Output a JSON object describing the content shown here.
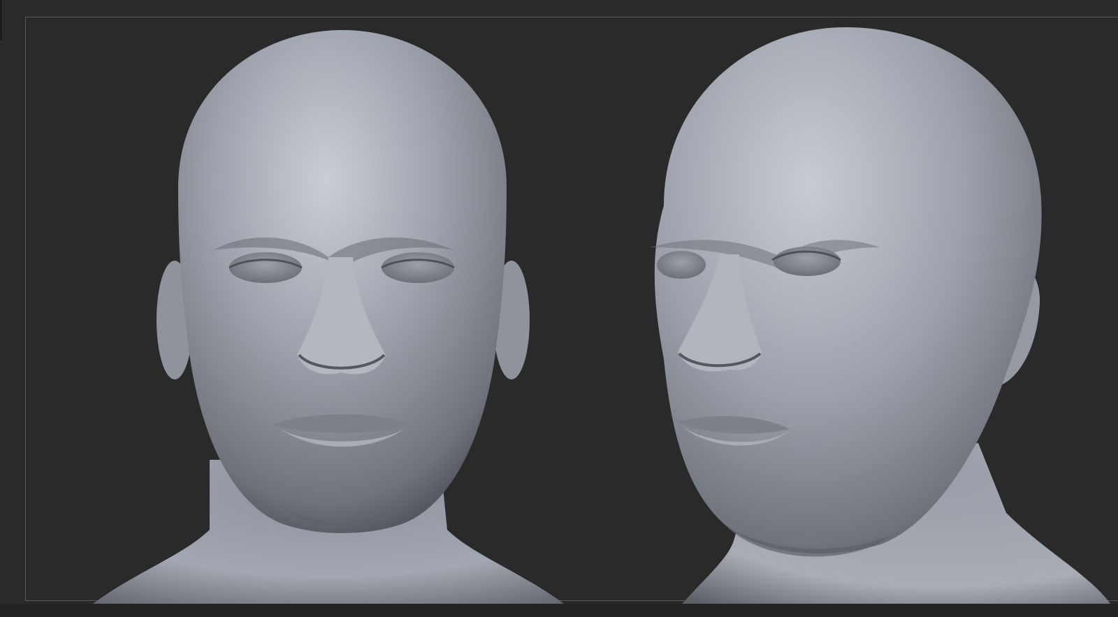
{
  "viewport": {
    "background": "#2a2a2a",
    "frame_color": "#5a5a5a"
  },
  "sculpts": [
    {
      "view": "front"
    },
    {
      "view": "three-quarter"
    }
  ]
}
